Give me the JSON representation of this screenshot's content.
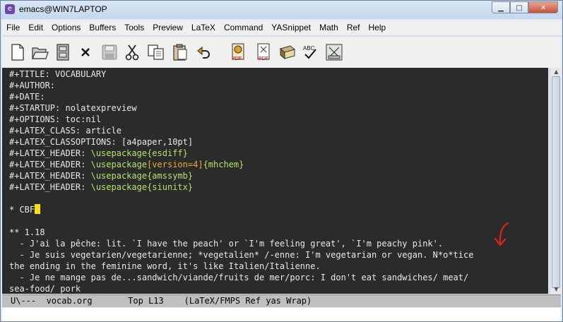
{
  "window": {
    "title": "emacs@WIN7LAPTOP",
    "app_icon": "emacs-icon"
  },
  "window_buttons": {
    "minimize": "▁",
    "maximize": "□",
    "close": "✕"
  },
  "menubar": [
    "File",
    "Edit",
    "Options",
    "Buffers",
    "Tools",
    "Preview",
    "LaTeX",
    "Command",
    "YASnippet",
    "Math",
    "Ref",
    "Help"
  ],
  "toolbar": {
    "icons": [
      "new-file-icon",
      "open-folder-icon",
      "cabinet-icon",
      "close-buffer-icon",
      "save-icon",
      "cut-icon",
      "copy-icon",
      "paste-icon",
      "undo-icon",
      "pdf-preview-icon",
      "pdf-icon",
      "book-icon",
      "spellcheck-icon",
      "latex-edit-icon"
    ],
    "pdf_label": "PDF",
    "spell_label": "ABC"
  },
  "editor": {
    "lines": {
      "l1": "#+TITLE: VOCABULARY",
      "l2": "#+AUTHOR:",
      "l3": "#+DATE:",
      "l4": "#+STARTUP: nolatexpreview",
      "l5": "#+OPTIONS: toc:nil",
      "l6": "#+LATEX_CLASS: article",
      "l7": "#+LATEX_CLASSOPTIONS: [a4paper,10pt]",
      "l8": {
        "prefix": "#+LATEX_HEADER: ",
        "cmd": "\\usepackage",
        "arg": "{esdiff}"
      },
      "l9": {
        "prefix": "#+LATEX_HEADER: ",
        "cmd": "\\usepackage",
        "opt": "[version=4]",
        "arg": "{mhchem}"
      },
      "l10": {
        "prefix": "#+LATEX_HEADER: ",
        "cmd": "\\usepackage",
        "arg": "{amssymb}"
      },
      "l11": {
        "prefix": "#+LATEX_HEADER: ",
        "cmd": "\\usepackage",
        "arg": "{siunitx}"
      },
      "l12": "* CBF",
      "l13": "** 1.18",
      "l14": "  - J'ai la pêche: lit. `I have the peach' or `I'm feeling great', `I'm peachy pink'.",
      "l15": "  - Je suis vegetarien/vegetarienne; *vegetalien* /-enne: I'm vegetarian or vegan. N*o*tice",
      "l16": "the ending in the feminine word, it's like Italien/Italienne.",
      "l17": "  - Je ne mange pas de...sandwich/viande/fruits de mer/porc: I don't eat sandwiches/ meat/",
      "l18": "sea-food/ pork"
    }
  },
  "modeline": "U\\---  vocab.org       Top L13    (LaTeX/FMPS Ref yas Wrap)",
  "colors": {
    "editor_bg": "#2b2b2b",
    "keyword": "#b5e06b",
    "argument": "#eba934",
    "cursor": "#ffe000",
    "annotation": "#e0231b"
  }
}
